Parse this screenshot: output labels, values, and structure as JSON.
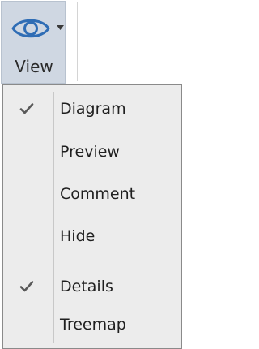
{
  "ribbon": {
    "view_button": {
      "label": "View",
      "icon": "eye-icon",
      "has_dropdown": true
    }
  },
  "menu": {
    "items": [
      {
        "label": "Diagram",
        "checked": true
      },
      {
        "label": "Preview",
        "checked": false
      },
      {
        "label": "Comment",
        "checked": false
      },
      {
        "label": "Hide",
        "checked": false
      },
      {
        "label": "Details",
        "checked": true
      },
      {
        "label": "Treemap",
        "checked": false
      }
    ]
  },
  "colors": {
    "icon_blue": "#2f6db5",
    "button_bg": "#cfd7e2",
    "menu_bg": "#ececec",
    "check_color": "#595959"
  }
}
